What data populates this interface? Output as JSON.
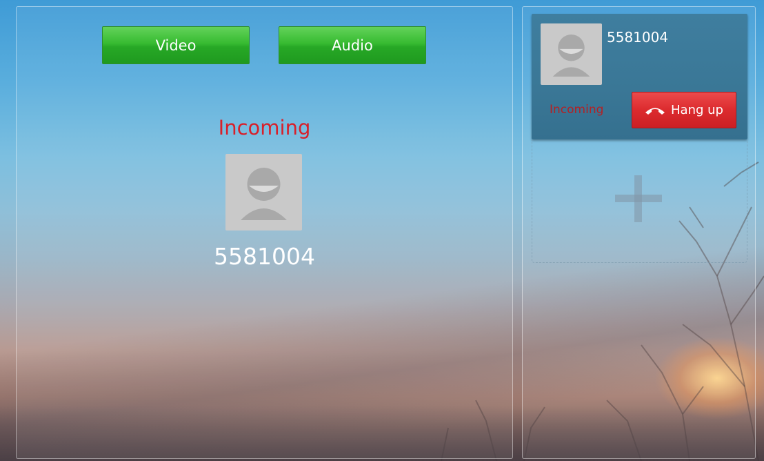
{
  "call": {
    "status": "Incoming",
    "number": "5581004"
  },
  "actions": {
    "video_label": "Video",
    "audio_label": "Audio",
    "hangup_label": "Hang up"
  },
  "line_card": {
    "number": "5581004",
    "status": "Incoming"
  },
  "icons": {
    "avatar": "person-placeholder-icon",
    "hangup": "phone-hangup-icon",
    "add": "plus-icon"
  },
  "colors": {
    "accept_green": "#27a826",
    "hangup_red": "#dc2b2e",
    "status_red": "#d8202a",
    "card_blue": "#3a7796"
  }
}
